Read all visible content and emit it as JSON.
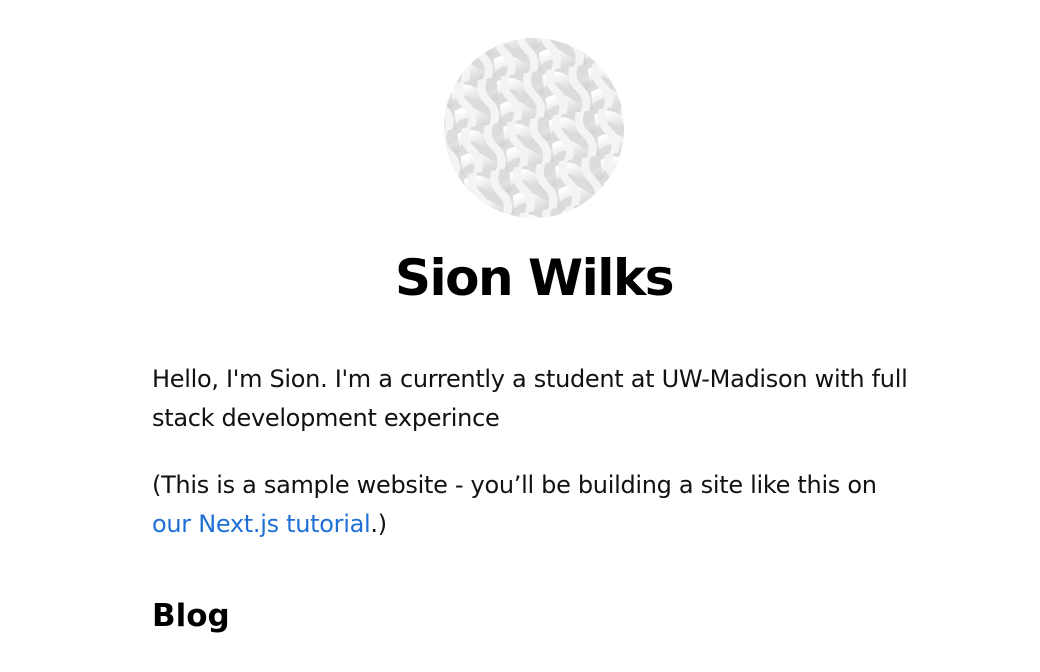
{
  "profile": {
    "name": "Sion Wilks",
    "avatar_icon": "woven-pattern-avatar"
  },
  "intro": {
    "text": "Hello, I'm Sion. I'm a currently a student at UW-Madison with full stack development experince"
  },
  "note": {
    "prefix": "(This is a sample website - you’ll be building a site like this on ",
    "link_text": "our Next.js tutorial",
    "suffix": ".)"
  },
  "sections": {
    "blog_heading": "Blog"
  },
  "colors": {
    "link": "#1f6fd6",
    "text": "#111111",
    "background": "#ffffff"
  }
}
